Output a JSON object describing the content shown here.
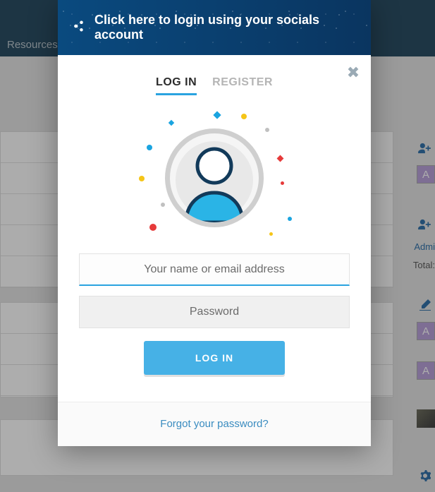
{
  "background": {
    "nav_resources": "Resources",
    "side": {
      "badge_a": "A",
      "admin_text": "Admi",
      "total_text": "Total:"
    }
  },
  "modal": {
    "social_banner": "Click here to login using your socials account",
    "tabs": {
      "login": "LOG IN",
      "register": "REGISTER"
    },
    "fields": {
      "username_placeholder": "Your name or email address",
      "password_placeholder": "Password"
    },
    "login_button": "LOG IN",
    "forgot_link": "Forgot your password?"
  }
}
